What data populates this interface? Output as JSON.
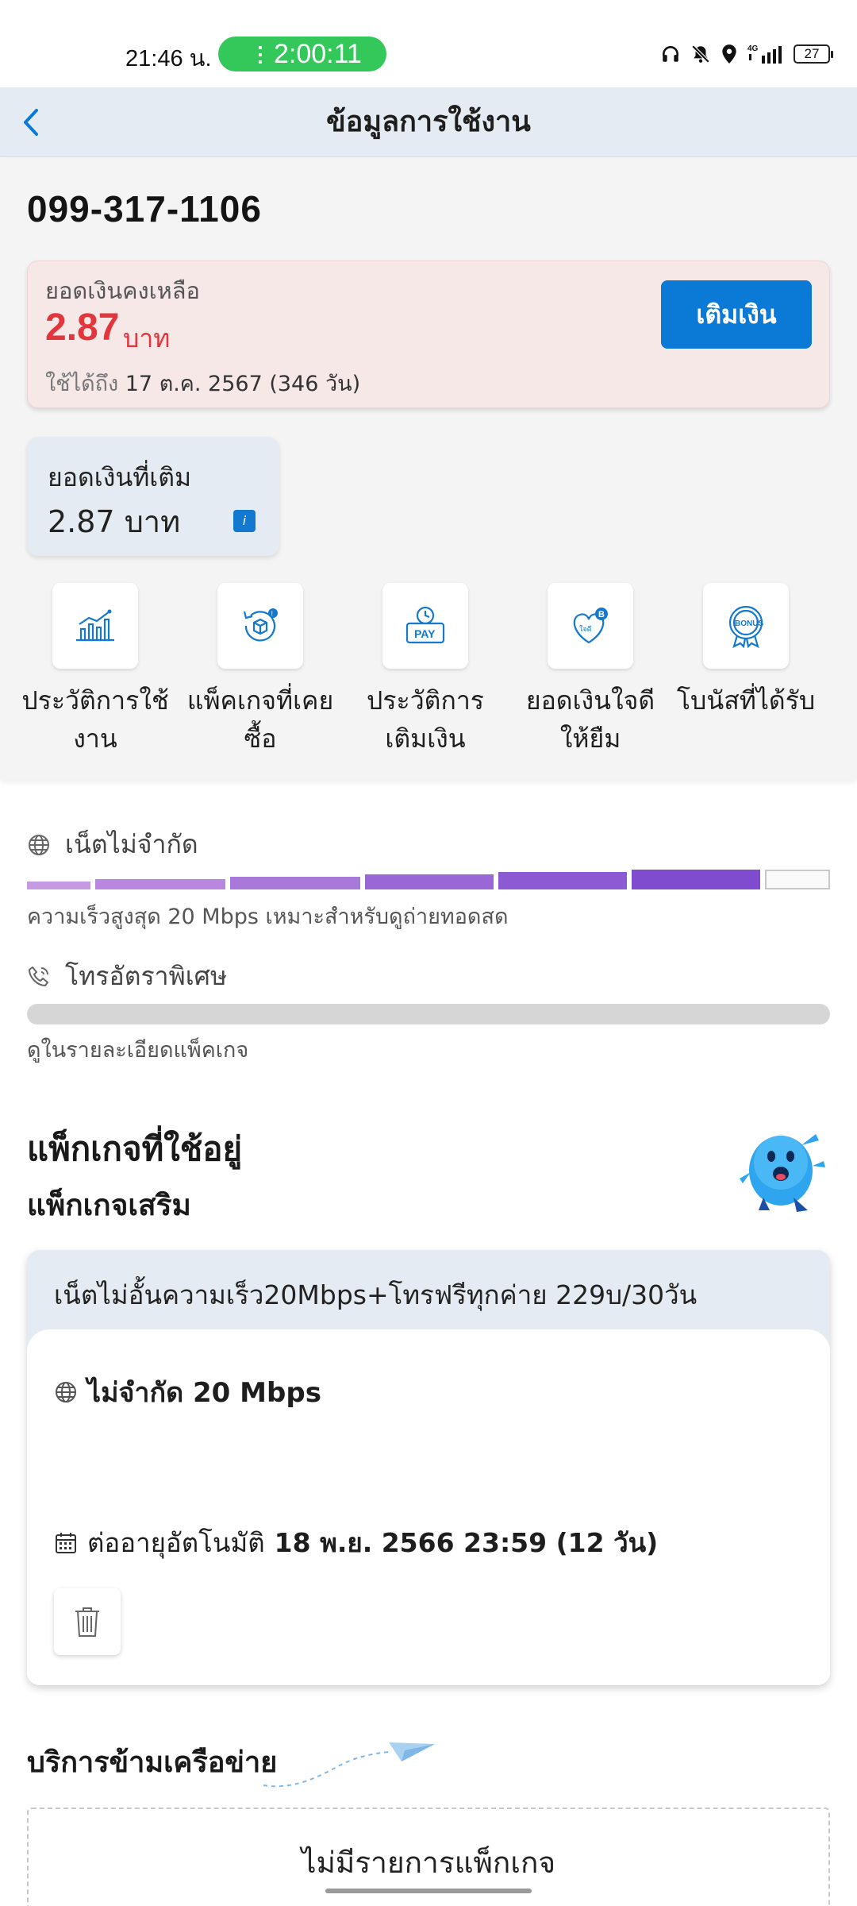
{
  "status_bar": {
    "time": "21:46 น.",
    "call_timer": "2:00:11",
    "network": "4G",
    "battery": "27"
  },
  "header": {
    "title": "ข้อมูลการใช้งาน"
  },
  "account": {
    "phone_number": "099-317-1106",
    "balance_label": "ยอดเงินคงเหลือ",
    "balance_amount": "2.87",
    "balance_unit": "บาท",
    "valid_prefix": "ใช้ได้ถึง",
    "valid_date": "17 ต.ค. 2567 (346 วัน)",
    "topup_label": "เติมเงิน",
    "topped_label": "ยอดเงินที่เติม",
    "topped_amount": "2.87 บาท"
  },
  "shortcuts": [
    {
      "line1": "ประวัติการใช้",
      "line2": "งาน",
      "icon": "usage-chart-icon"
    },
    {
      "line1": "แพ็คเกจที่เคย",
      "line2": "ซื้อ",
      "icon": "package-history-icon"
    },
    {
      "line1": "ประวัติการ",
      "line2": "เติมเงิน",
      "icon": "pay-history-icon"
    },
    {
      "line1": "ยอดเงินใจดี",
      "line2": "ให้ยืม",
      "icon": "loan-heart-icon"
    },
    {
      "line1": "โบนัสที่ได้รับ",
      "line2": "",
      "icon": "bonus-badge-icon"
    }
  ],
  "usage": {
    "internet_title": "เน็ตไม่จำกัด",
    "internet_note": "ความเร็วสูงสุด 20 Mbps เหมาะสำหรับดูถ่ายทอดสด",
    "call_title": "โทรอัตราพิเศษ",
    "call_note": "ดูในรายละเอียดแพ็คเกจ"
  },
  "packages": {
    "title": "แพ็กเกจที่ใช้อยู่",
    "subtitle": "แพ็กเกจเสริม",
    "items": [
      {
        "name": "เน็ตไม่อั้นความเร็ว20Mbps+โทรฟรีทุกค่าย 229บ/30วัน",
        "feature": "ไม่จำกัด 20 Mbps",
        "renew_label": "ต่ออายุอัตโนมัติ",
        "renew_date": "18 พ.ย. 2566 23:59 (12 วัน)"
      }
    ]
  },
  "roaming": {
    "title": "บริการข้ามเครือข่าย",
    "empty_text": "ไม่มีรายการแพ็กเกจ"
  },
  "colors": {
    "accent": "#0a7ad6",
    "balance": "#e2363c",
    "header_bg": "#e5ebf2",
    "call_pill": "#34c85a"
  }
}
